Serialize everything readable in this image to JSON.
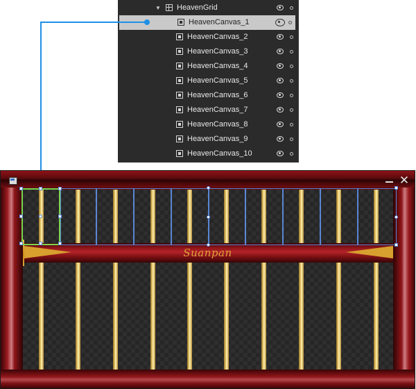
{
  "objects_panel": {
    "grid": {
      "label": "HeavenGrid"
    },
    "canvases": [
      {
        "label": "HeavenCanvas_1",
        "selected": true
      },
      {
        "label": "HeavenCanvas_2"
      },
      {
        "label": "HeavenCanvas_3"
      },
      {
        "label": "HeavenCanvas_4"
      },
      {
        "label": "HeavenCanvas_5"
      },
      {
        "label": "HeavenCanvas_6"
      },
      {
        "label": "HeavenCanvas_7"
      },
      {
        "label": "HeavenCanvas_8"
      },
      {
        "label": "HeavenCanvas_9"
      },
      {
        "label": "HeavenCanvas_10"
      }
    ]
  },
  "window": {
    "title_text": "Suanpan",
    "controls": {
      "minimize_glyph": "—",
      "close_glyph": "✕"
    }
  },
  "colors": {
    "selection_line": "#1e90e6",
    "grid_outline": "#5a86d6",
    "canvas_outline": "#7ad650",
    "frame_red": "#8a1418",
    "rod_gold": "#f3d87a"
  },
  "icons": [
    "grid-icon",
    "canvas-icon",
    "eye-icon",
    "lock-dot-icon",
    "expand-arrow-icon",
    "window-icon",
    "minimize-icon",
    "close-icon"
  ]
}
